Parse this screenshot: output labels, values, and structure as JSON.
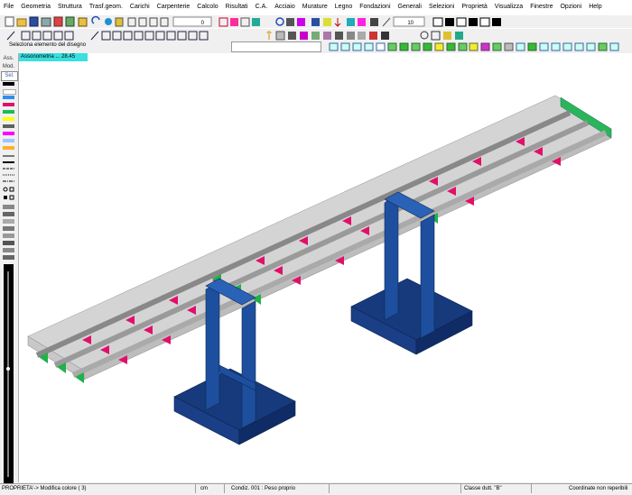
{
  "menu": [
    "File",
    "Geometria",
    "Struttura",
    "Trasf.geom.",
    "Carichi",
    "Carpenterie",
    "Calcolo",
    "Risultati",
    "C.A.",
    "Acciaio",
    "Murature",
    "Legno",
    "Fondazioni",
    "Generali",
    "Selezioni",
    "Proprietà",
    "Visualizza",
    "Finestre",
    "Opzioni",
    "Help"
  ],
  "toolbar": {
    "zoom_value": "0",
    "num_value": "10"
  },
  "prompt": {
    "text": "Seleziona  elemento del disegno"
  },
  "left_panel": {
    "tab1": "Ass.",
    "tab2": "Mod.",
    "tab3": "Sel."
  },
  "view": {
    "label": "Assonometria ... 28.45"
  },
  "status": {
    "message": "PROPRIETA'-> Modifica colore ( 3)",
    "units": "cm",
    "condition": "Condiz. 001 : Peso proprio",
    "ductility": "Classe dutt. \"B\"",
    "coords": "Coordinate non reperibili"
  },
  "colors": {
    "deck": "#d6d6d6",
    "pier": "#1d4f9e",
    "footing": "#173a7c",
    "stiffener_red": "#e0106a",
    "stiffener_green": "#21b04b",
    "support_green": "#36c05c"
  },
  "palette": [
    "#000000",
    "#ffffff",
    "#2d8ff0",
    "#e0106a",
    "#1fb956",
    "#ffff00",
    "#606060",
    "#ff00ff",
    "#9cc4ff",
    "#ffb030"
  ]
}
